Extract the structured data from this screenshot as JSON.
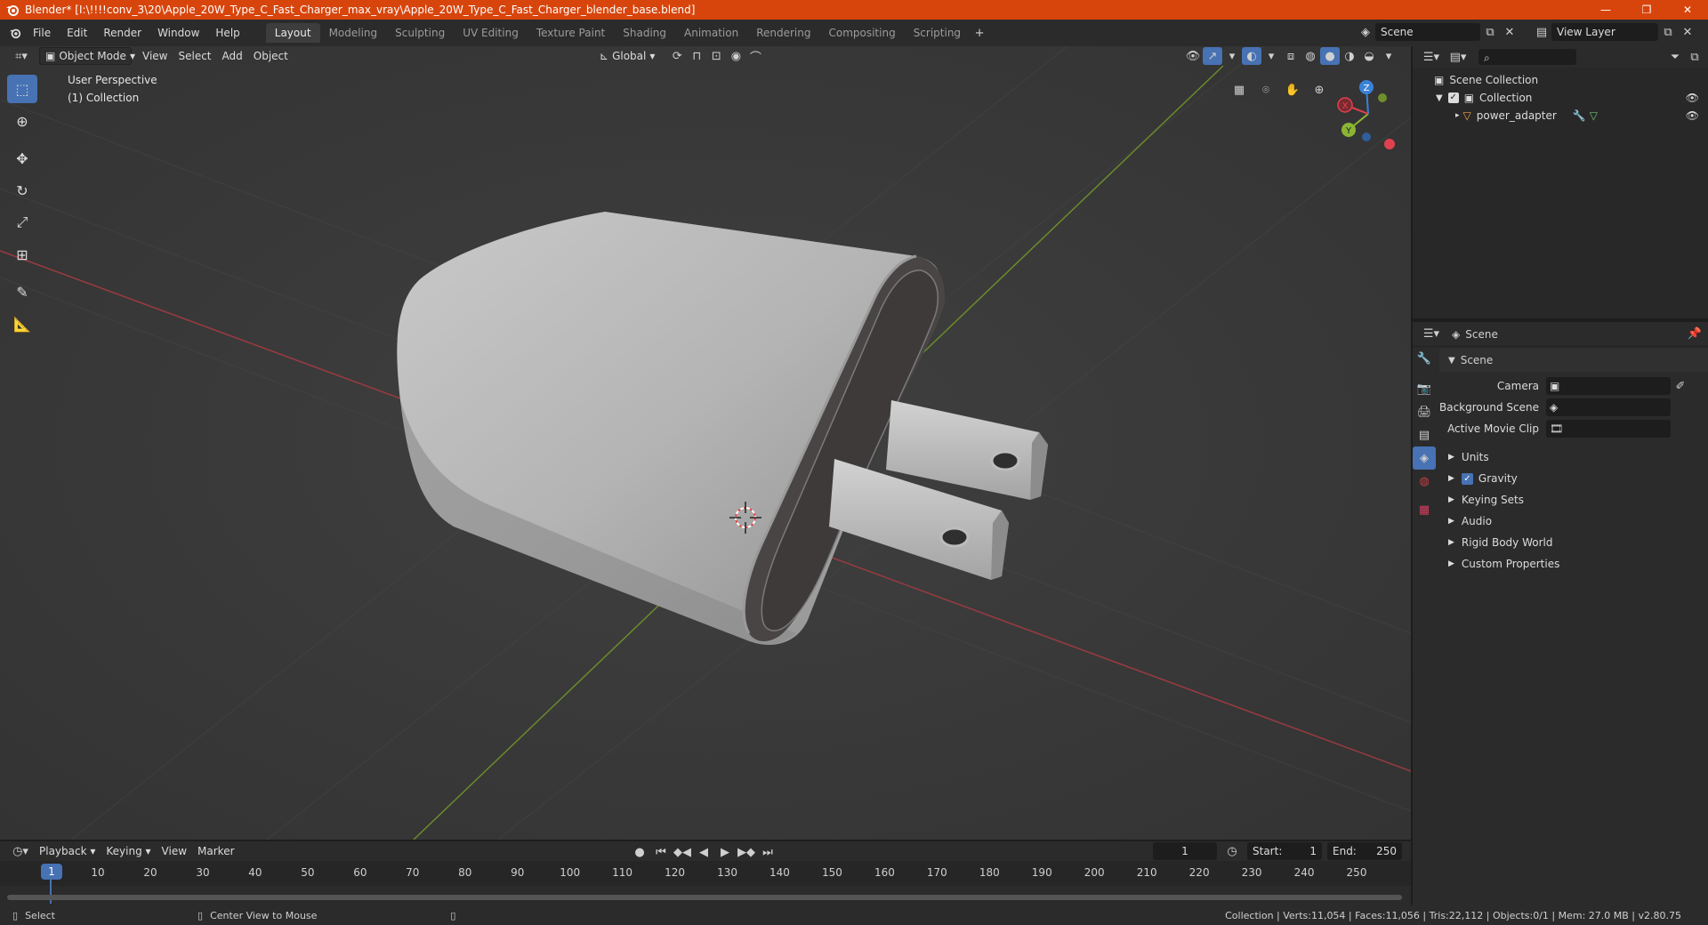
{
  "window": {
    "title": "Blender* [I:\\!!!!conv_3\\20\\Apple_20W_Type_C_Fast_Charger_max_vray\\Apple_20W_Type_C_Fast_Charger_blender_base.blend]",
    "minimize": "—",
    "maximize": "❐",
    "close": "✕"
  },
  "menu": [
    "File",
    "Edit",
    "Render",
    "Window",
    "Help"
  ],
  "workspaces": [
    "Layout",
    "Modeling",
    "Sculpting",
    "UV Editing",
    "Texture Paint",
    "Shading",
    "Animation",
    "Rendering",
    "Compositing",
    "Scripting"
  ],
  "active_workspace": "Layout",
  "scene_name": "Scene",
  "view_layer": "View Layer",
  "viewport": {
    "mode": "Object Mode",
    "menus": [
      "View",
      "Select",
      "Add",
      "Object"
    ],
    "transform_orientation": "Global",
    "overlay_text_1": "User Perspective",
    "overlay_text_2": "(1) Collection",
    "gizmo_axes": [
      "X",
      "Y",
      "Z"
    ]
  },
  "outliner": {
    "root": "Scene Collection",
    "collection": "Collection",
    "object": "power_adapter"
  },
  "properties": {
    "header": "Scene",
    "panel_title": "Scene",
    "camera_label": "Camera",
    "background_scene_label": "Background Scene",
    "active_movie_clip_label": "Active Movie Clip",
    "sections": [
      "Units",
      "Gravity",
      "Keying Sets",
      "Audio",
      "Rigid Body World",
      "Custom Properties"
    ],
    "gravity_checked": true
  },
  "timeline": {
    "menus": [
      "Playback",
      "Keying",
      "View",
      "Marker"
    ],
    "current_frame": "1",
    "start_label": "Start:",
    "start": "1",
    "end_label": "End:",
    "end": "250",
    "ticks": [
      "1",
      "10",
      "20",
      "30",
      "40",
      "50",
      "60",
      "70",
      "80",
      "90",
      "100",
      "110",
      "120",
      "130",
      "140",
      "150",
      "160",
      "170",
      "180",
      "190",
      "200",
      "210",
      "220",
      "230",
      "240",
      "250"
    ]
  },
  "statusbar": {
    "select": "Select",
    "center_view": "Center View to Mouse",
    "stats": "Collection | Verts:11,054 | Faces:11,056 | Tris:22,112 | Objects:0/1 | Mem: 27.0 MB | v2.80.75"
  },
  "colors": {
    "titlebar": "#d8450c",
    "accent": "#4772b3",
    "x_axis": "#e0414f",
    "y_axis": "#8ab534",
    "z_axis": "#3a82d8"
  }
}
